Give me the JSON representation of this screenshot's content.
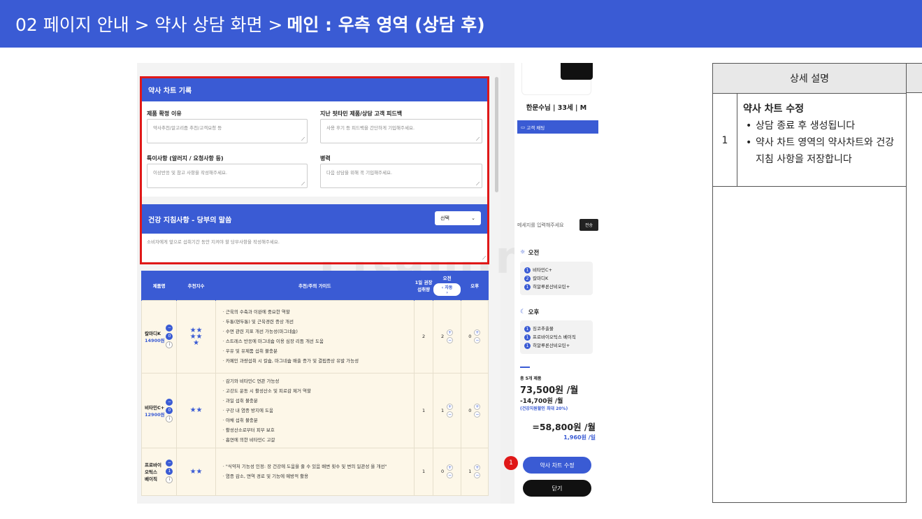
{
  "header": {
    "breadcrumb": "02 페이지 안내 > 약사 상담 화면 > ",
    "bold": "메인 : 우측 영역 (상담 후)"
  },
  "watermark": "Fitamin",
  "chart_record": {
    "title": "약사 차트 기록",
    "f1_label": "제품 확정 이유",
    "f1_ph": "약사추천/알고리즘 추천/고객요청 등",
    "f2_label": "지난 핏타민 제품/상담 고객 피드백",
    "f2_ph": "사용 후기 등 피드백을 간단하게 기입해주세요.",
    "f3_label": "특이사항 (알러지 / 요청사항 등)",
    "f3_ph": "이상반응 및 참고 사항을 작성해주세요.",
    "f4_label": "병력",
    "f4_ph": "다음 상담을 위해 꼭 기입해주세요."
  },
  "guidance": {
    "title": "건강 지침사항 - 당부의 말씀",
    "select": "선택",
    "ph": "소비자에게 앞으로 섭취기간 동안 지켜야 할 당부사항을 작성해주세요."
  },
  "table": {
    "headers": [
      "제품명",
      "추천지수",
      "추천/주의 가이드",
      "1일 권장 섭취량",
      "오전",
      "오후"
    ],
    "toggle_label": "자동",
    "rows": [
      {
        "name": "칼마디K",
        "price": "14900원",
        "stars": "★★\n★★\n★",
        "badge": "0",
        "daily": "2",
        "am": "2",
        "pm": "0",
        "guide": [
          "근육의 수축과 이완에 중요한 역할",
          "두통(편두통) 및 근육경련 증상 개선",
          "수면 관련 지표 개선 가능성(마그네슘)",
          "스트레스 반응에 마그네슘 이용 심장 리듬 개선 도움",
          "우유 및 유제품 섭취 불충분",
          "카페인 과량섭취 시 칼슘, 마그네슘 배출 증가 및 결핍증상 유발 가능성"
        ]
      },
      {
        "name": "비타민C+",
        "price": "12900원",
        "stars": "★★",
        "badge": "0",
        "daily": "1",
        "am": "1",
        "pm": "0",
        "guide": [
          "감기와 비타민C 연관 가능성",
          "고강도 운동 시 활성산소 및 피로감 제거 역할",
          "과일 섭취 불충분",
          "구강 내 염증 방지에 도움",
          "야채 섭취 불충분",
          "활성산소로부터 피부 보호",
          "흡연에 의한 비타민C 고갈"
        ]
      },
      {
        "name": "프로바이오틱스\n베이직",
        "price": "",
        "stars": "★★",
        "badge": "1",
        "daily": "1",
        "am": "0",
        "pm": "1",
        "guide": [
          "\"식약처 기능성 인정: 장 건강에 도움을 줄 수 있음 배변 횟수 및 변의 일관성 을 개선\"",
          "염증 감소, 면역 경로 및 기능에 예방적 활용"
        ]
      }
    ]
  },
  "right": {
    "customer": "한문수님 | 33세 | M",
    "chat_title": "고객 채팅",
    "chat_ph": "메세지를 입력해주세요",
    "send": "전송",
    "am_title": "오전",
    "am_items": [
      "비타민C+",
      "칼마디K",
      "히알루론산비오틴+"
    ],
    "am_nums": [
      "1",
      "2",
      "1"
    ],
    "pm_title": "오후",
    "pm_items": [
      "징코추출물",
      "프로바이오틱스 베이직",
      "히알루론산비오틴+"
    ],
    "pm_nums": [
      "1",
      "1",
      "1"
    ],
    "total_label": "총 5개 제품",
    "total_price": "73,500원 /월",
    "discount": "-14,700원 /월",
    "discount_note": "(건강지원할인 최대 20%)",
    "final": "=58,800원 /월",
    "daily": "1,960원 /일",
    "edit_btn": "약사 차트 수정",
    "close_btn": "닫기"
  },
  "marker": "1",
  "desc": {
    "header": "상세 설명",
    "num": "1",
    "title": "약사 차트 수정",
    "b1": "상담 종료 후 생성됩니다",
    "b2": "약사 차트 영역의 약사차트와 건강 지침 사항을 저장합니다"
  },
  "colors": {
    "accent": "#3a5bd4",
    "marker": "#e01818",
    "table_bg": "#fdf7e8"
  }
}
